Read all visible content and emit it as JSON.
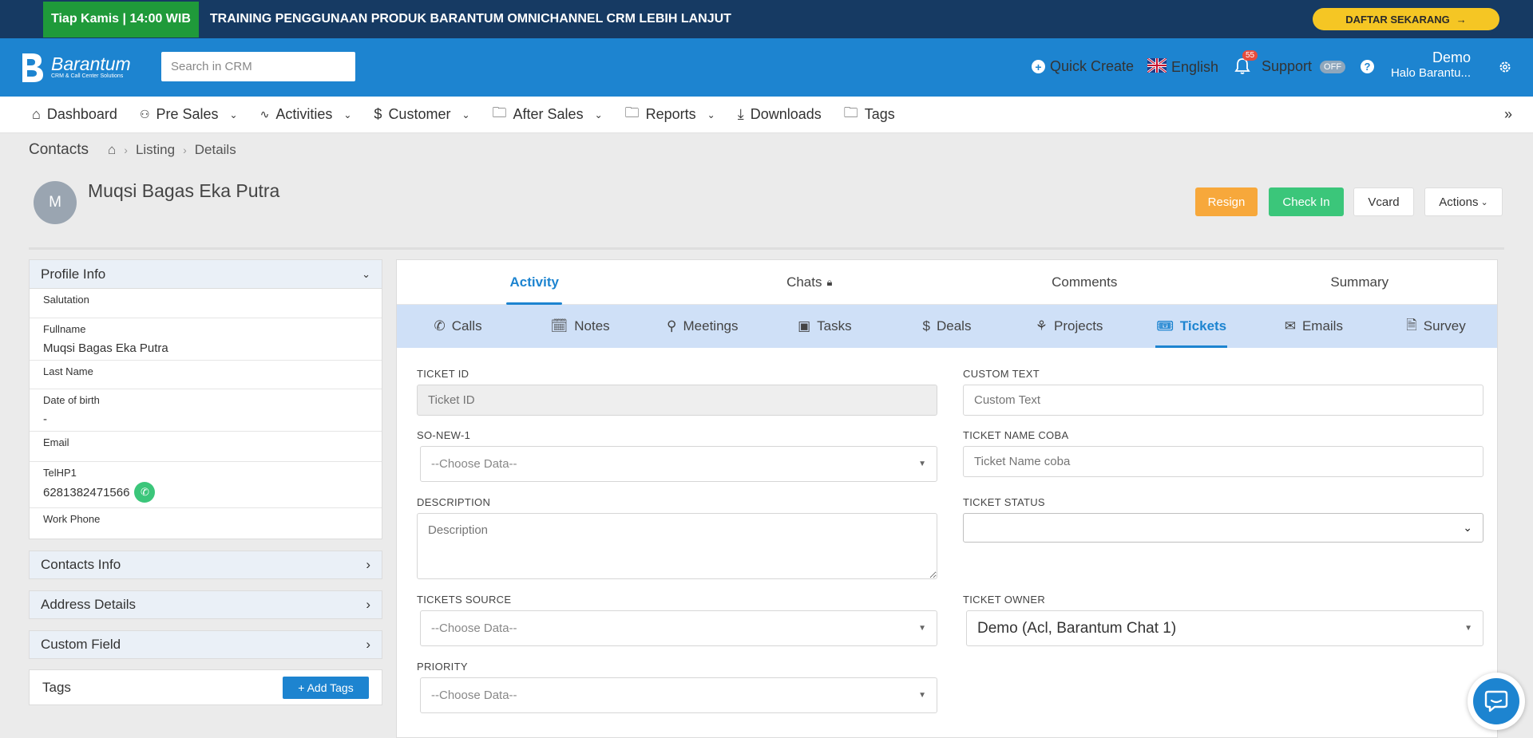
{
  "promo": {
    "schedule": "Tiap Kamis | 14:00 WIB",
    "headline": "TRAINING PENGGUNAAN PRODUK BARANTUM OMNICHANNEL CRM LEBIH LANJUT",
    "cta": "DAFTAR SEKARANG",
    "cta_icon": "arrow-right-icon"
  },
  "header": {
    "brand": "Barantum",
    "brand_sub": "CRM & Call Center Solutions",
    "search_placeholder": "Search in CRM",
    "quick_create": "Quick Create",
    "language": "English",
    "notification_count": "55",
    "support": "Support",
    "support_status": "OFF",
    "user_name": "Demo",
    "user_sub": "Halo Barantu..."
  },
  "nav": {
    "items": [
      {
        "label": "Dashboard",
        "icon": "home-icon",
        "dropdown": false
      },
      {
        "label": "Pre Sales",
        "icon": "users-icon",
        "dropdown": true
      },
      {
        "label": "Activities",
        "icon": "pulse-icon",
        "dropdown": true
      },
      {
        "label": "Customer",
        "icon": "dollar-icon",
        "dropdown": true
      },
      {
        "label": "After Sales",
        "icon": "folder-icon",
        "dropdown": true
      },
      {
        "label": "Reports",
        "icon": "folder-icon",
        "dropdown": true
      },
      {
        "label": "Downloads",
        "icon": "download-icon",
        "dropdown": false
      },
      {
        "label": "Tags",
        "icon": "folder-icon",
        "dropdown": false
      }
    ]
  },
  "breadcrumb": {
    "module": "Contacts",
    "items": [
      "Listing",
      "Details"
    ]
  },
  "record": {
    "initial": "M",
    "name": "Muqsi Bagas Eka Putra",
    "buttons": {
      "resign": "Resign",
      "check_in": "Check In",
      "vcard": "Vcard",
      "actions": "Actions"
    }
  },
  "profile": {
    "title": "Profile Info",
    "fields": {
      "salutation": {
        "label": "Salutation",
        "value": ""
      },
      "fullname": {
        "label": "Fullname",
        "value": "Muqsi Bagas Eka Putra"
      },
      "last_name": {
        "label": "Last Name",
        "value": ""
      },
      "dob": {
        "label": "Date of birth",
        "value": "-"
      },
      "email": {
        "label": "Email",
        "value": ""
      },
      "telhp1": {
        "label": "TelHP1",
        "value": "6281382471566"
      },
      "work_phone": {
        "label": "Work Phone",
        "value": ""
      }
    },
    "sections": [
      "Contacts Info",
      "Address Details",
      "Custom Field"
    ],
    "tags_title": "Tags",
    "add_tags": "+ Add Tags"
  },
  "tabs": {
    "main": [
      "Activity",
      "Chats",
      "Comments",
      "Summary"
    ],
    "active_main": "Activity",
    "sub": [
      {
        "label": "Calls",
        "icon": "phone-icon"
      },
      {
        "label": "Notes",
        "icon": "calendar-note-icon"
      },
      {
        "label": "Meetings",
        "icon": "map-pin-icon"
      },
      {
        "label": "Tasks",
        "icon": "briefcase-icon"
      },
      {
        "label": "Deals",
        "icon": "dollar-icon"
      },
      {
        "label": "Projects",
        "icon": "hierarchy-icon"
      },
      {
        "label": "Tickets",
        "icon": "ticket-icon"
      },
      {
        "label": "Emails",
        "icon": "mail-icon"
      },
      {
        "label": "Survey",
        "icon": "document-icon"
      }
    ],
    "active_sub": "Tickets"
  },
  "form": {
    "ticket_id": {
      "label": "TICKET ID",
      "placeholder": "Ticket ID"
    },
    "custom_text": {
      "label": "CUSTOM TEXT",
      "placeholder": "Custom Text"
    },
    "so_new_1": {
      "label": "SO-NEW-1",
      "value": "--Choose Data--"
    },
    "ticket_name_coba": {
      "label": "TICKET NAME COBA",
      "placeholder": "Ticket Name coba"
    },
    "description": {
      "label": "DESCRIPTION",
      "placeholder": "Description"
    },
    "ticket_status": {
      "label": "TICKET STATUS",
      "value": ""
    },
    "tickets_source": {
      "label": "TICKETS SOURCE",
      "value": "--Choose Data--"
    },
    "ticket_owner": {
      "label": "TICKET OWNER",
      "value": "Demo (Acl, Barantum Chat 1)"
    },
    "priority": {
      "label": "PRIORITY",
      "value": "--Choose Data--"
    }
  }
}
